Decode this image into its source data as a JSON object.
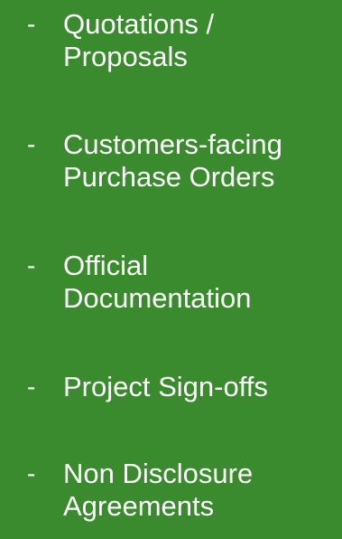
{
  "slide": {
    "background_color": "#3a8a2e",
    "text_color": "#ffffff",
    "bullet_marker": "-",
    "items": [
      {
        "label": "Quotations  /\nProposals"
      },
      {
        "label": "Customers-facing\nPurchase Orders"
      },
      {
        "label": "Official\nDocumentation"
      },
      {
        "label": "Project Sign-offs"
      },
      {
        "label": "Non Disclosure\nAgreements"
      }
    ]
  }
}
